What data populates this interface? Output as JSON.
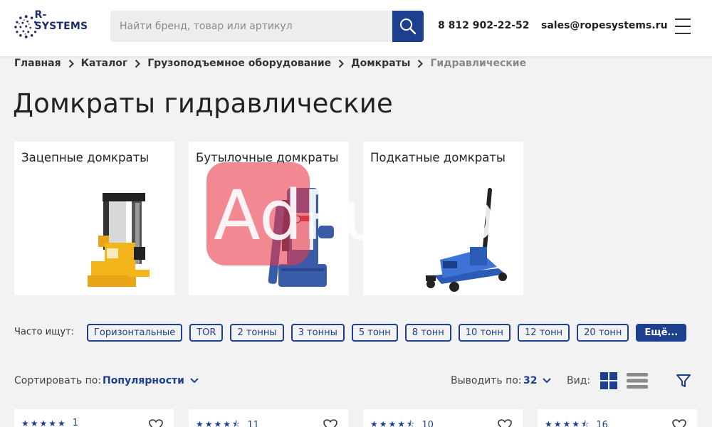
{
  "header": {
    "logo_text": "R-SYSTEMS",
    "search_placeholder": "Найти бренд, товар или артикул",
    "phone": "8 812 902-22-52",
    "email": "sales@ropesystems.ru"
  },
  "breadcrumb": [
    "Главная",
    "Каталог",
    "Грузоподъемное оборудование",
    "Домкраты",
    "Гидравлические"
  ],
  "page_title": "Домкраты гидравлические",
  "categories": [
    {
      "title": "Зацепные домкраты"
    },
    {
      "title": "Бутылочные домкраты"
    },
    {
      "title": "Подкатные домкраты"
    }
  ],
  "watermark_text": "AdPump",
  "frequent": {
    "label": "Часто ищут:",
    "chips": [
      "Горизонтальные",
      "TOR",
      "2 тонны",
      "3 тонны",
      "5 тонн",
      "8 тонн",
      "10 тонн",
      "12 тонн",
      "20 тонн"
    ],
    "more": "Ещё..."
  },
  "sort": {
    "label": "Сортировать по:",
    "value": "Популярности",
    "show_label": "Выводить по:",
    "show_value": "32",
    "view_label": "Вид:"
  },
  "products": [
    {
      "rating": 5,
      "reviews": "1"
    },
    {
      "rating": 4.5,
      "reviews": "11"
    },
    {
      "rating": 4.5,
      "reviews": "10"
    },
    {
      "rating": 4.5,
      "reviews": "16"
    }
  ],
  "colors": {
    "accent": "#1d3f8f",
    "watermark": "#e8394a",
    "jack_yellow": "#f2b51b",
    "jack_blue": "#2b5bb5"
  }
}
